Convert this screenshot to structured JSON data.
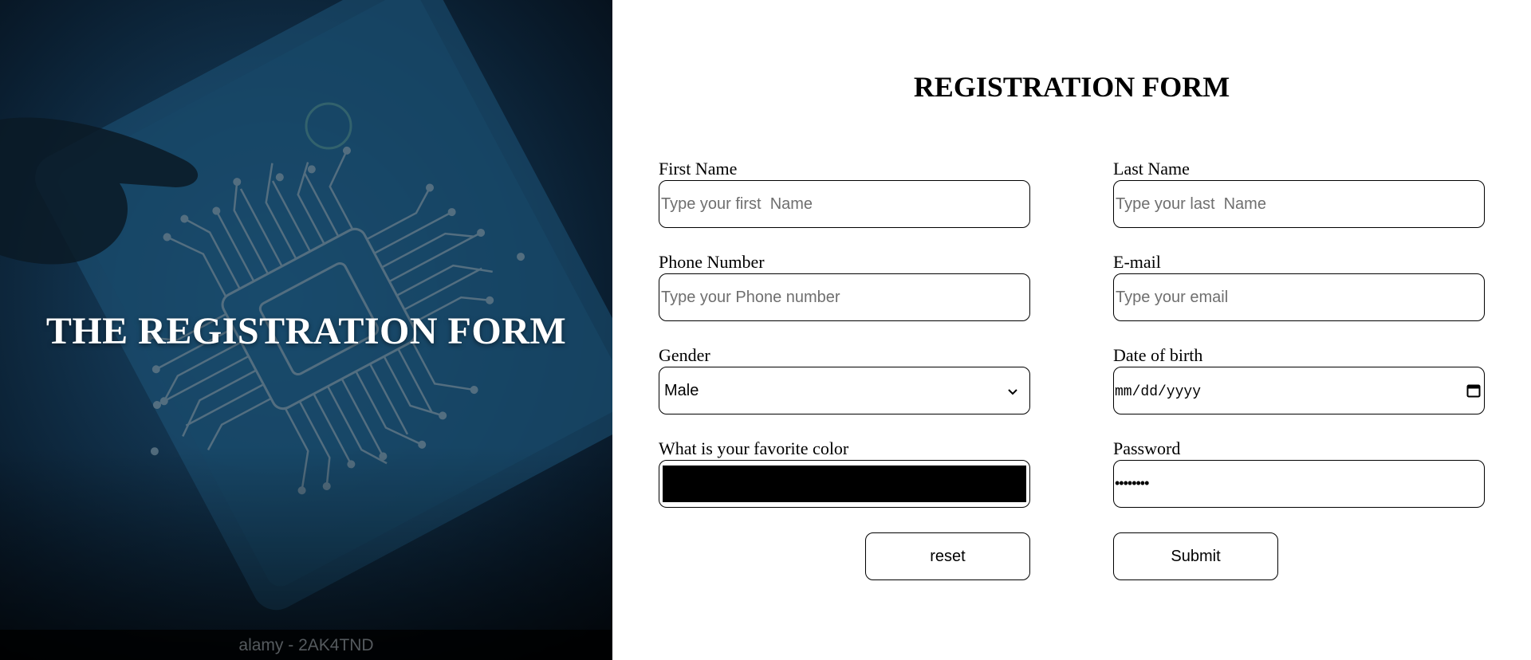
{
  "hero": {
    "title": "THE REGISTRATION FORM",
    "watermark": "alamy - 2AK4TND",
    "background_accent": "#12344f"
  },
  "form": {
    "title": "REGISTRATION FORM",
    "fields": {
      "first_name": {
        "label": "First Name",
        "placeholder": "Type your first  Name",
        "value": ""
      },
      "last_name": {
        "label": "Last Name",
        "placeholder": "Type your last  Name",
        "value": ""
      },
      "phone": {
        "label": "Phone Number",
        "placeholder": "Type your Phone number",
        "value": ""
      },
      "email": {
        "label": "E-mail",
        "placeholder": "Type your email",
        "value": ""
      },
      "gender": {
        "label": "Gender",
        "selected": "Male",
        "options": [
          "Male"
        ]
      },
      "dob": {
        "label": "Date of birth",
        "display": "mm/dd/yyyy"
      },
      "color": {
        "label": "What is your favorite color",
        "value": "#000000"
      },
      "password": {
        "label": "Password",
        "masked": "••••••••"
      }
    },
    "buttons": {
      "reset": "reset",
      "submit": "Submit"
    }
  }
}
